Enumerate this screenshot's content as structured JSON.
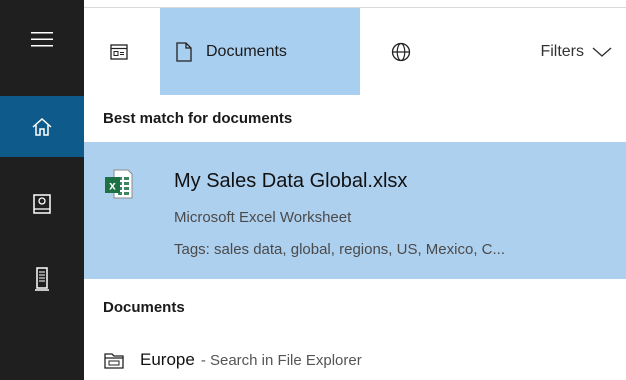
{
  "rail": {
    "items": [
      {
        "name": "menu-icon"
      },
      {
        "name": "home-icon"
      },
      {
        "name": "notebook-icon"
      },
      {
        "name": "device-icon"
      }
    ],
    "active_color": "#0e5a8a",
    "bg_color": "#1f1f1f"
  },
  "header": {
    "tabs": [
      {
        "icon": "apps-icon",
        "label": ""
      },
      {
        "icon": "document-icon",
        "label": "Documents",
        "selected": true
      },
      {
        "icon": "globe-icon",
        "label": ""
      }
    ],
    "filters_label": "Filters",
    "filters_icon": "chevron-down-icon",
    "selected_color": "#a8cff0"
  },
  "best_match": {
    "section_title": "Best match for documents",
    "item": {
      "icon": "excel-icon",
      "name": "My Sales Data Global.xlsx",
      "type": "Microsoft Excel Worksheet",
      "tags": "Tags: sales data, global, regions, US, Mexico, C..."
    },
    "highlight_color": "#aed0ef"
  },
  "documents": {
    "section_title": "Documents",
    "items": [
      {
        "icon": "file-explorer-icon",
        "title": "Europe",
        "subtitle": "- Search in File Explorer"
      }
    ]
  }
}
